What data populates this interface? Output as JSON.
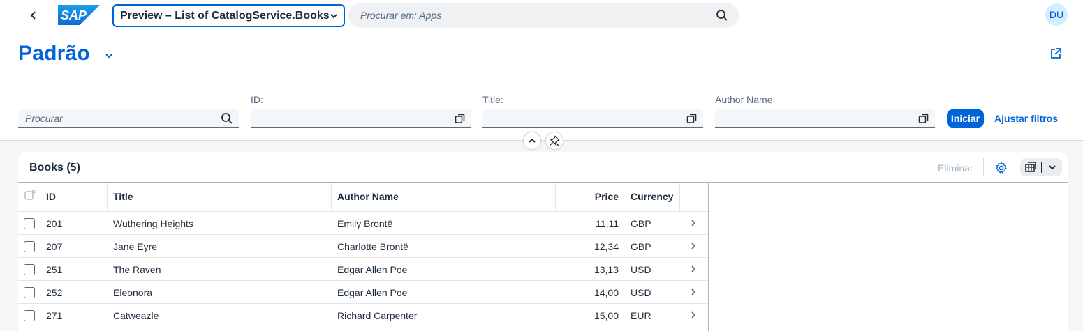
{
  "shell": {
    "logo_text": "SAP",
    "app_title": "Preview – List of CatalogService.Books",
    "search_placeholder": "Procurar em: Apps",
    "avatar_initials": "DU"
  },
  "page": {
    "variant_title": "Padrão"
  },
  "filters": {
    "search_placeholder": "Procurar",
    "fields": [
      {
        "label": "ID:"
      },
      {
        "label": "Title:"
      },
      {
        "label": "Author Name:"
      }
    ],
    "go_label": "Iniciar",
    "adapt_label": "Ajustar filtros"
  },
  "table": {
    "title": "Books (5)",
    "delete_label": "Eliminar",
    "columns": [
      "ID",
      "Title",
      "Author Name",
      "Price",
      "Currency"
    ],
    "rows": [
      {
        "id": "201",
        "title": "Wuthering Heights",
        "author": "Emily Brontë",
        "price": "11,11",
        "currency": "GBP"
      },
      {
        "id": "207",
        "title": "Jane Eyre",
        "author": "Charlotte Brontë",
        "price": "12,34",
        "currency": "GBP"
      },
      {
        "id": "251",
        "title": "The Raven",
        "author": "Edgar Allen Poe",
        "price": "13,13",
        "currency": "USD"
      },
      {
        "id": "252",
        "title": "Eleonora",
        "author": "Edgar Allen Poe",
        "price": "14,00",
        "currency": "USD"
      },
      {
        "id": "271",
        "title": "Catweazle",
        "author": "Richard Carpenter",
        "price": "15,00",
        "currency": "EUR"
      }
    ]
  },
  "colors": {
    "brand_blue": "#0064d9",
    "sap_logo_blue": "#0a6ed1",
    "text": "#1d2d3e",
    "muted": "#556b82"
  }
}
